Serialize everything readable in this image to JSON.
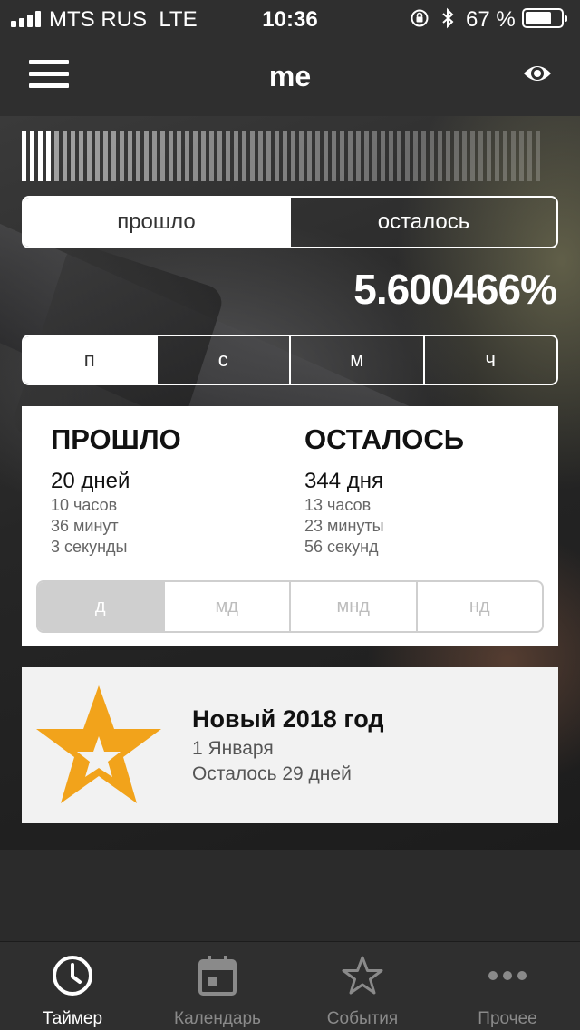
{
  "status_bar": {
    "carrier": "MTS RUS",
    "network": "LTE",
    "time": "10:36",
    "battery_percent": "67 %"
  },
  "nav": {
    "title": "me",
    "menu_icon": "hamburger-menu-icon",
    "visibility_icon": "eye-icon"
  },
  "progress": {
    "fraction": 0.056,
    "percent_text": "5.600466%"
  },
  "mode_toggle": {
    "options": [
      "прошло",
      "осталось"
    ],
    "selected": "прошло"
  },
  "unit_toggle": {
    "options": [
      "п",
      "с",
      "м",
      "ч"
    ],
    "selected": "п"
  },
  "stats": {
    "passed": {
      "heading": "ПРОШЛО",
      "main": "20 дней",
      "details": [
        "10 часов",
        "36 минут",
        "3 секунды"
      ]
    },
    "remaining": {
      "heading": "ОСТАЛОСЬ",
      "main": "344 дня",
      "details": [
        "13 часов",
        "23 минуты",
        "56 секунд"
      ]
    },
    "format_options": [
      "д",
      "мд",
      "мнд",
      "нд"
    ],
    "format_selected": "д"
  },
  "event": {
    "icon": "star-icon",
    "title": "Новый 2018 год",
    "date": "1 Января",
    "remaining": "Осталось 29 дней",
    "accent": "#f2a31b"
  },
  "tabbar": {
    "items": [
      {
        "label": "Таймер",
        "icon": "clock-icon",
        "active": true
      },
      {
        "label": "Календарь",
        "icon": "calendar-icon",
        "active": false
      },
      {
        "label": "События",
        "icon": "star-outline-icon",
        "active": false
      },
      {
        "label": "Прочее",
        "icon": "more-icon",
        "active": false
      }
    ]
  }
}
